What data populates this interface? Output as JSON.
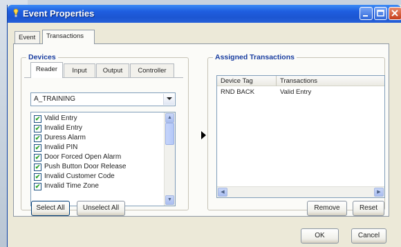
{
  "window": {
    "title": "Event Properties"
  },
  "tabs": [
    {
      "label": "Event",
      "active": false
    },
    {
      "label": "Transactions",
      "active": true
    }
  ],
  "devices": {
    "title": "Devices",
    "subtabs": [
      {
        "label": "Reader",
        "active": true
      },
      {
        "label": "Input",
        "active": false
      },
      {
        "label": "Output",
        "active": false
      },
      {
        "label": "Controller",
        "active": false
      }
    ],
    "selected_device": "A_TRAINING",
    "transactions": [
      {
        "label": "Valid Entry",
        "checked": true
      },
      {
        "label": "Invalid Entry",
        "checked": true
      },
      {
        "label": "Duress Alarm",
        "checked": true
      },
      {
        "label": "Invalid PIN",
        "checked": true
      },
      {
        "label": "Door Forced Open Alarm",
        "checked": true
      },
      {
        "label": "Push Button Door Release",
        "checked": true
      },
      {
        "label": "Invalid Customer Code",
        "checked": true
      },
      {
        "label": "Invalid Time Zone",
        "checked": true
      }
    ],
    "select_all": "Select All",
    "unselect_all": "Unselect All"
  },
  "assigned": {
    "title": "Assigned Transactions",
    "columns": [
      "Device Tag",
      "Transactions"
    ],
    "rows": [
      {
        "device_tag": "RND BACK",
        "transaction": "Valid Entry"
      }
    ],
    "remove": "Remove",
    "reset": "Reset"
  },
  "footer": {
    "ok": "OK",
    "cancel": "Cancel"
  },
  "colors": {
    "titlebar": "#1f5fe0",
    "group_title": "#1a3ea0",
    "check": "#21a121"
  }
}
